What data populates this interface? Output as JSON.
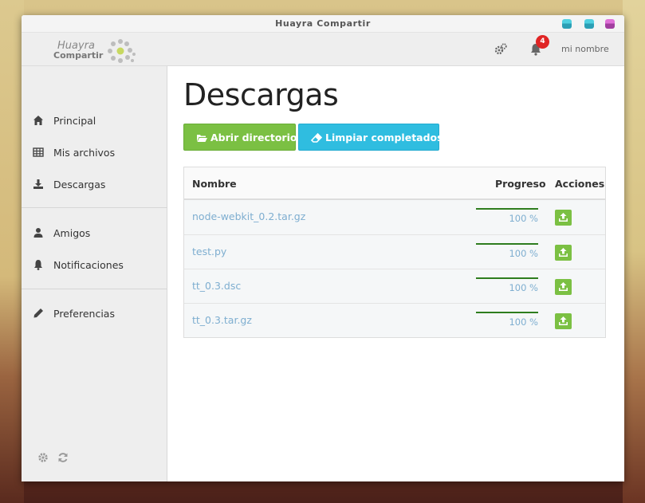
{
  "window": {
    "title": "Huayra Compartir"
  },
  "brand": {
    "line1": "Huayra",
    "line2": "Compartir"
  },
  "topnav": {
    "notification_count": "4",
    "username": "mi nombre"
  },
  "sidebar": {
    "items": [
      {
        "label": "Principal",
        "icon": "home-icon"
      },
      {
        "label": "Mis archivos",
        "icon": "table-icon"
      },
      {
        "label": "Descargas",
        "icon": "download-icon"
      },
      {
        "label": "Amigos",
        "icon": "user-icon"
      },
      {
        "label": "Notificaciones",
        "icon": "bell-icon"
      },
      {
        "label": "Preferencias",
        "icon": "pencil-icon"
      }
    ]
  },
  "main": {
    "title": "Descargas",
    "open_dir_label": "Abrir directorio",
    "clear_label": "Limpiar completados",
    "table": {
      "headers": {
        "name": "Nombre",
        "progress": "Progreso",
        "actions": "Acciones"
      },
      "rows": [
        {
          "name": "node-webkit_0.2.tar.gz",
          "progress": 100,
          "progress_text": "100 %"
        },
        {
          "name": "test.py",
          "progress": 100,
          "progress_text": "100 %"
        },
        {
          "name": "tt_0.3.dsc",
          "progress": 100,
          "progress_text": "100 %"
        },
        {
          "name": "tt_0.3.tar.gz",
          "progress": 100,
          "progress_text": "100 %"
        }
      ]
    }
  },
  "colors": {
    "success": "#7bc043",
    "info": "#2fbde0",
    "link": "#7eaed0",
    "badge": "#e02424",
    "progress": "#2e7d1e"
  }
}
